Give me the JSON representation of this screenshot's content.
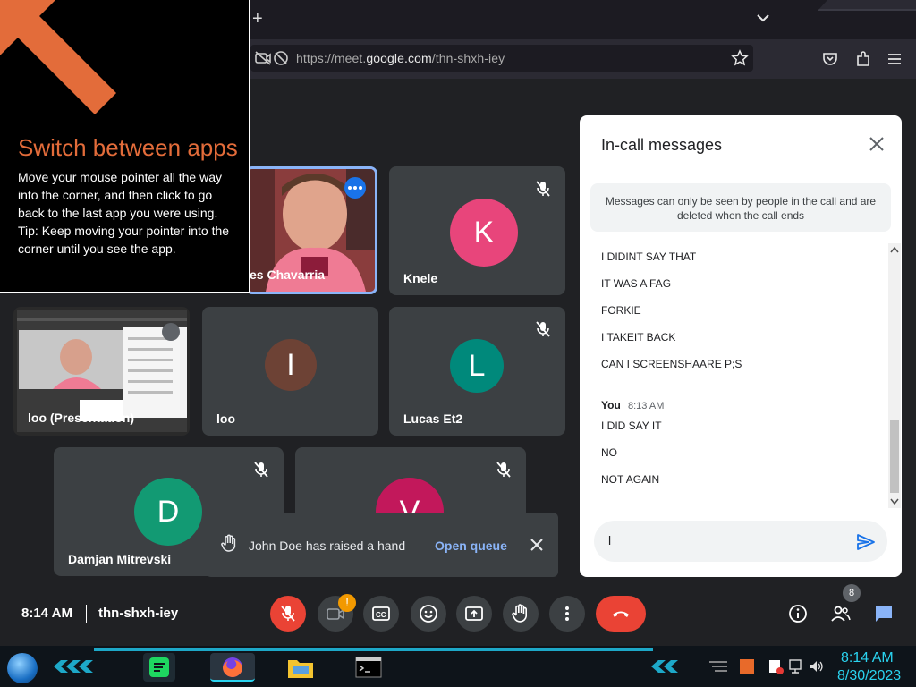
{
  "browser": {
    "new_tab_label": "+",
    "url_prefix": "https://meet.",
    "url_domain": "google.com",
    "url_path": "/thn-shxh-iey"
  },
  "tip": {
    "title": "Switch between apps",
    "body_1": "Move your mouse pointer all the way into the corner, and then click to go back to the last app you were using.",
    "body_2": "Tip: Keep moving your pointer into the corner until you see the app.",
    "accent": "#e36c3a"
  },
  "tiles": [
    {
      "name": "es Chavarria",
      "active": true
    },
    {
      "name": "Knele",
      "initial": "K",
      "color": "#e8457b",
      "muted": true
    },
    {
      "name": "loo (Presentation)"
    },
    {
      "name": "loo",
      "initial": "I",
      "color": "#6d4235"
    },
    {
      "name": "Lucas Et2",
      "initial": "L",
      "color": "#00897b",
      "muted": true
    },
    {
      "name": "Damjan Mitrevski",
      "initial": "D",
      "color": "#129a73",
      "muted": true
    },
    {
      "name": "",
      "initial": "V",
      "color": "#c2185b",
      "muted": true
    }
  ],
  "chat": {
    "title": "In-call messages",
    "notice": "Messages can only be seen by people in the call and are deleted when the call ends",
    "messages_top": [
      "I DIDINT SAY THAT",
      "IT WAS A FAG",
      "FORKIE",
      "I TAKEIT BACK",
      "CAN I SCREENSHAARE P;S"
    ],
    "sender": "You",
    "sender_time": "8:13 AM",
    "messages_bottom": [
      "I DID SAY IT",
      "NO",
      "NOT AGAIN"
    ],
    "input_value": "l"
  },
  "toast": {
    "text": "John Doe has raised a hand",
    "link": "Open queue"
  },
  "controls": {
    "time": "8:14 AM",
    "meeting_code": "thn-shxh-iey",
    "camera_badge": "!",
    "people_count": "8",
    "red": "#ea4335",
    "blue": "#8ab4f8"
  },
  "taskbar": {
    "clock_time": "8:14 AM",
    "clock_date": "8/30/2023"
  }
}
